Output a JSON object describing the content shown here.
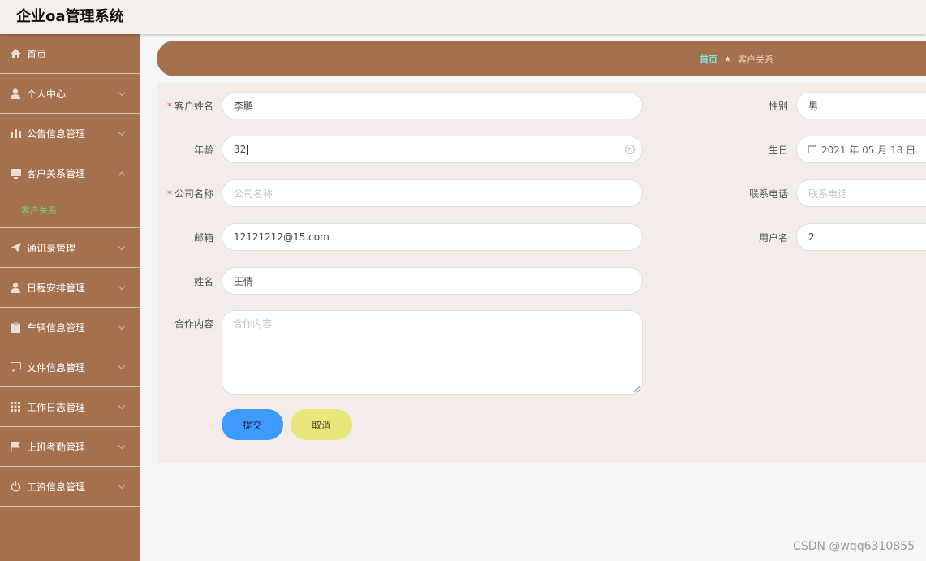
{
  "app": {
    "title": "企业oa管理系统"
  },
  "sidebar": {
    "items": [
      {
        "label": "首页",
        "icon": "home-icon"
      },
      {
        "label": "个人中心",
        "icon": "user-icon"
      },
      {
        "label": "公告信息管理",
        "icon": "bar-chart-icon"
      },
      {
        "label": "客户关系管理",
        "icon": "monitor-icon",
        "expanded": true
      },
      {
        "label": "通讯录管理",
        "icon": "send-icon"
      },
      {
        "label": "日程安排管理",
        "icon": "user-icon"
      },
      {
        "label": "车辆信息管理",
        "icon": "clipboard-icon"
      },
      {
        "label": "文件信息管理",
        "icon": "chat-icon"
      },
      {
        "label": "工作日志管理",
        "icon": "grid-icon"
      },
      {
        "label": "上班考勤管理",
        "icon": "flag-icon"
      },
      {
        "label": "工资信息管理",
        "icon": "power-icon"
      }
    ],
    "submenu": {
      "label": "客户关系"
    }
  },
  "breadcrumb": {
    "home": "首页",
    "separator": "★",
    "current": "客户关系"
  },
  "form": {
    "customer_name": {
      "label": "客户姓名",
      "value": "李鹏",
      "required": true
    },
    "gender": {
      "label": "性别",
      "value": "男"
    },
    "age": {
      "label": "年龄",
      "value": "32"
    },
    "birthday": {
      "label": "生日",
      "value": "2021 年 05 月 18 日"
    },
    "company": {
      "label": "公司名称",
      "placeholder": "公司名称",
      "required": true
    },
    "phone": {
      "label": "联系电话",
      "placeholder": "联系电话"
    },
    "email": {
      "label": "邮箱",
      "value": "12121212@15.com"
    },
    "username": {
      "label": "用户名",
      "value": "2"
    },
    "name": {
      "label": "姓名",
      "value": "王倩"
    },
    "cooperation": {
      "label": "合作内容",
      "placeholder": "合作内容"
    },
    "submit_label": "提交",
    "cancel_label": "取消",
    "required_mark": "*"
  },
  "colors": {
    "sidebar_bg": "#a5704d",
    "topbar_bg": "#f4efeb",
    "submenu_active": "#6fd36f",
    "breadcrumb_home": "#7fe5e0",
    "submit_button": "#3d9bff",
    "cancel_button": "#e8e77c"
  },
  "watermark": "CSDN @wqq6310855"
}
